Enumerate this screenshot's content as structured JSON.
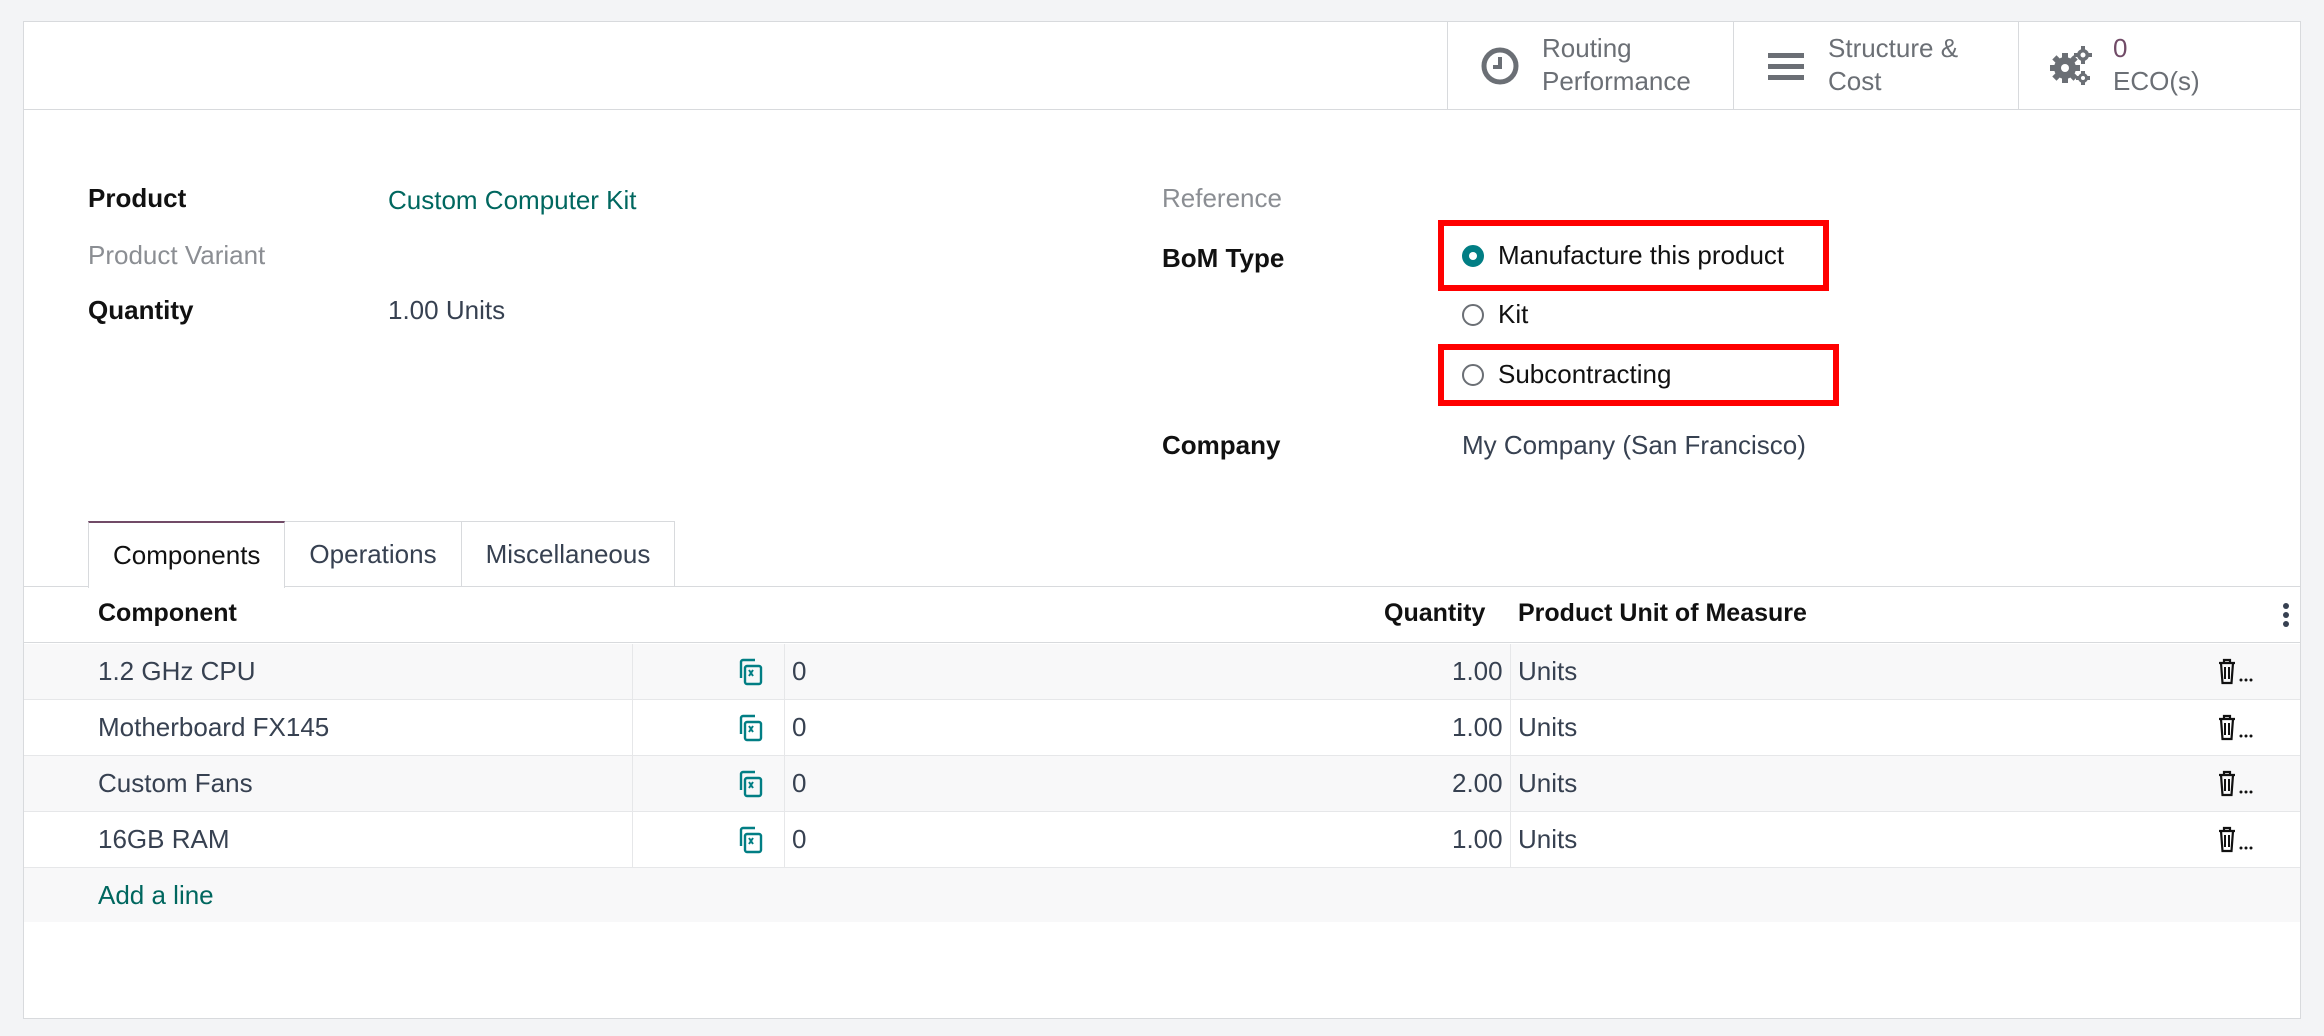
{
  "smart_buttons": {
    "routing": {
      "line1": "Routing",
      "line2": "Performance",
      "icon": "clock-icon"
    },
    "structure": {
      "line1": "Structure &",
      "line2": "Cost",
      "icon": "bars-icon"
    },
    "eco": {
      "count": "0",
      "label": "ECO(s)",
      "icon": "gears-icon"
    }
  },
  "form": {
    "product_label": "Product",
    "product_value": "Custom Computer Kit",
    "variant_label": "Product Variant",
    "quantity_label": "Quantity",
    "quantity_value": "1.00",
    "quantity_uom": "Units",
    "reference_label": "Reference",
    "bom_type_label": "BoM Type",
    "bom_type_options": [
      {
        "label": "Manufacture this product",
        "selected": true
      },
      {
        "label": "Kit",
        "selected": false
      },
      {
        "label": "Subcontracting",
        "selected": false
      }
    ],
    "company_label": "Company",
    "company_value": "My Company (San Francisco)"
  },
  "tabs": [
    {
      "label": "Components",
      "active": true
    },
    {
      "label": "Operations",
      "active": false
    },
    {
      "label": "Miscellaneous",
      "active": false
    }
  ],
  "table": {
    "headers": {
      "component": "Component",
      "quantity": "Quantity",
      "uom": "Product Unit of Measure"
    },
    "rows": [
      {
        "component": "1.2 GHz CPU",
        "extra": "0",
        "quantity": "1.00",
        "uom": "Units"
      },
      {
        "component": "Motherboard FX145",
        "extra": "0",
        "quantity": "1.00",
        "uom": "Units"
      },
      {
        "component": "Custom Fans",
        "extra": "0",
        "quantity": "2.00",
        "uom": "Units"
      },
      {
        "component": "16GB RAM",
        "extra": "0",
        "quantity": "1.00",
        "uom": "Units"
      }
    ],
    "add_line": "Add a line"
  },
  "colors": {
    "accent": "#017e84",
    "brand": "#714b67",
    "highlight": "#ff0000"
  }
}
